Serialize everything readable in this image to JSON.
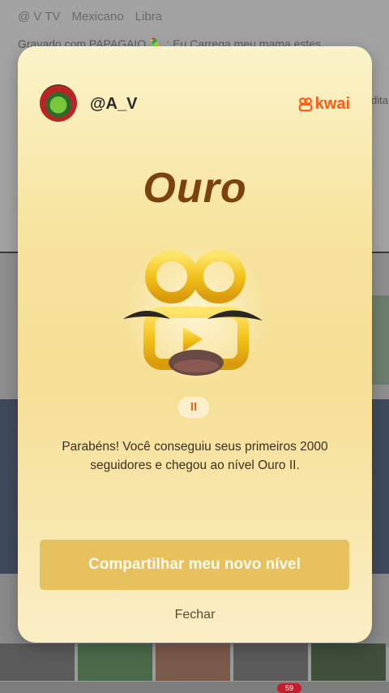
{
  "background": {
    "meta_items": [
      "@ V TV",
      "Mexicano",
      "Libra"
    ],
    "caption": "Gravado com PAPAGAIO 🦜 : Eu Carrega meu mama estes",
    "side_text": "dita",
    "notification_count": "59"
  },
  "modal": {
    "username": "@A_V",
    "brand": "kwai",
    "level_title": "Ouro",
    "level_pill": "II",
    "message": "Parabéns! Você conseguiu seus primeiros 2000 seguidores e chegou ao nível Ouro II.",
    "share_label": "Compartilhar meu novo nível",
    "close_label": "Fechar"
  },
  "colors": {
    "brand": "#ff5b1a",
    "title": "#7a4210",
    "button": "#e8c15f",
    "badge_gold": "#f2c21a"
  },
  "icons": {
    "avatar": "parrot-avatar",
    "brand": "kwai-logo-icon",
    "badge": "kwai-gold-badge-icon"
  }
}
